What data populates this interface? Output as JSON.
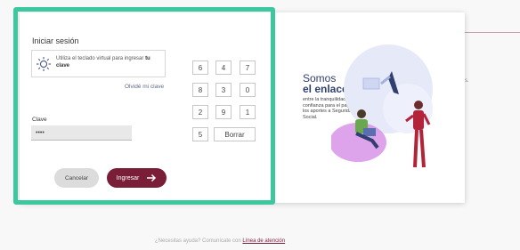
{
  "login": {
    "title": "Iniciar sesión",
    "info_text": "Utiliza el teclado virtual para ingresar",
    "info_bold": "tu clave",
    "forgot_link": "Olvidé mi clave",
    "key_label": "Clave",
    "key_value": "••••",
    "cancel_label": "Cancelar",
    "login_label": "Ingresar"
  },
  "keypad": {
    "keys": [
      "6",
      "4",
      "7",
      "8",
      "3",
      "0",
      "2",
      "9",
      "1",
      "5"
    ],
    "delete_label": "Borrar"
  },
  "promo": {
    "title_line1": "Somos",
    "title_line2": "el enlace",
    "text": "entre la tranquilidad y la confianza para el pago de los aportes a Seguridad Social."
  },
  "footer": {
    "text": "¿Necesitas ayuda? Comunícate con",
    "link": "Línea de atención"
  },
  "colors": {
    "accent": "#7a1e38",
    "highlight": "#3cc79e",
    "promo_title": "#2f3f6e"
  }
}
